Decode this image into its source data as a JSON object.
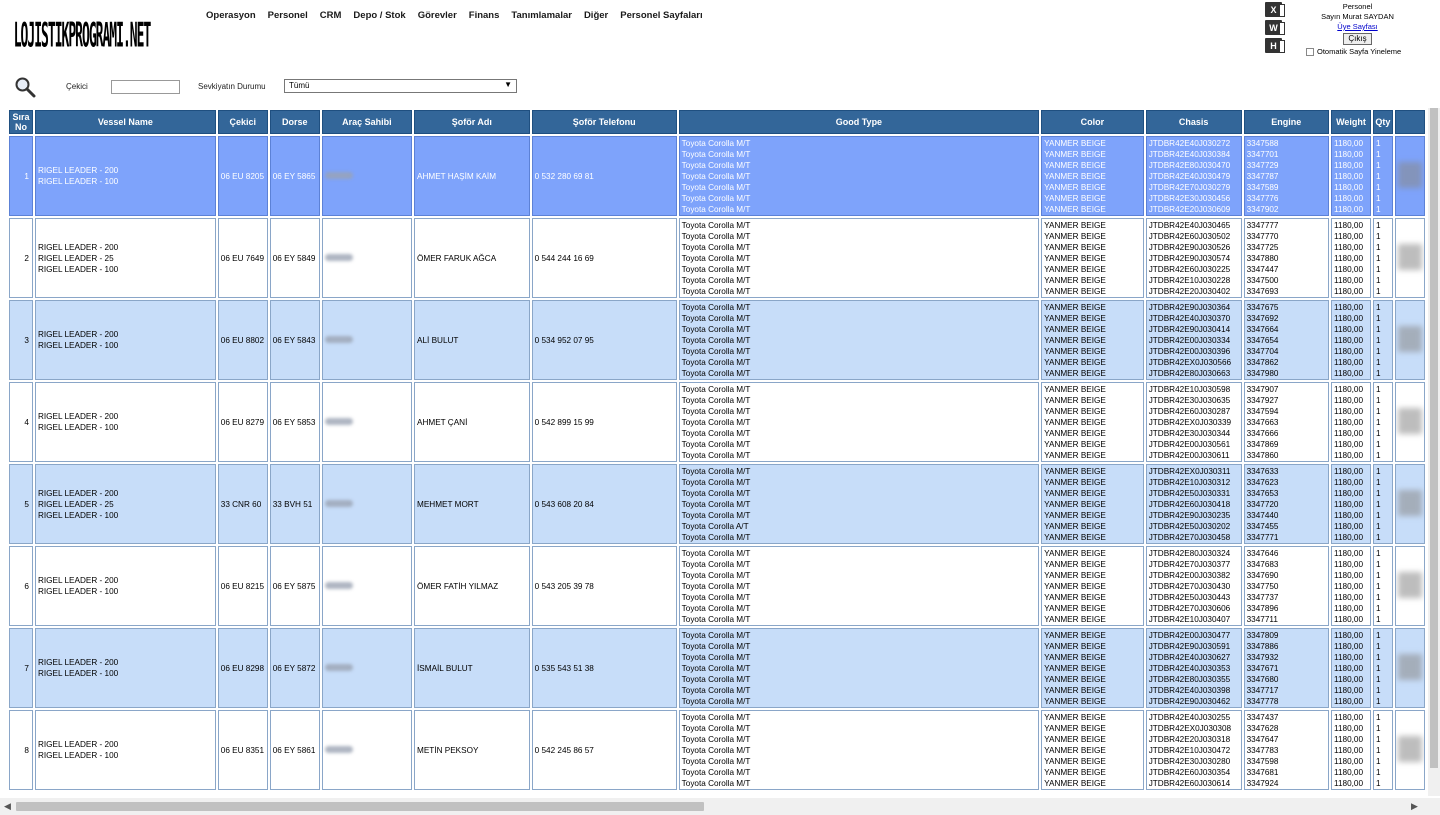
{
  "brand": {
    "logo_text": "LOJISTIKPROGRAMI.NET"
  },
  "menu": [
    "Operasyon",
    "Personel",
    "CRM",
    "Depo / Stok",
    "Görevler",
    "Finans",
    "Tanımlamalar",
    "Diğer",
    "Personel Sayfaları"
  ],
  "export": {
    "icons": [
      "excel-icon",
      "word-icon",
      "html-icon"
    ],
    "letters": [
      "X",
      "W",
      "H"
    ]
  },
  "user": {
    "role": "Personel",
    "greeting": "Sayın Murat SAYDAN",
    "profile_link": "Üye Sayfası",
    "logout": "Çıkış",
    "auto_refresh": "Otomatik Sayfa Yineleme"
  },
  "filters": {
    "cekici_label": "Çekici",
    "cekici_value": "",
    "status_label": "Sevkiyatın Durumu",
    "status_value": "Tümü"
  },
  "table": {
    "columns": [
      "Sıra No",
      "Vessel Name",
      "Çekici",
      "Dorse",
      "Araç Sahibi",
      "Şoför Adı",
      "Şoför Telefonu",
      "Good Type",
      "Color",
      "Chasis",
      "Engine",
      "Weight",
      "Qty"
    ],
    "rows": [
      {
        "no": "1",
        "vessels": [
          "RIGEL LEADER - 200",
          "RIGEL LEADER - 100"
        ],
        "cekici": "06 EU 8205",
        "dorse": "06 EY 5865",
        "driver": "AHMET HAŞİM KAİM",
        "phone": "0 532 280 69 81",
        "goods": [
          "Toyota Corolla M/T",
          "Toyota Corolla M/T",
          "Toyota Corolla M/T",
          "Toyota Corolla M/T",
          "Toyota Corolla M/T",
          "Toyota Corolla M/T",
          "Toyota Corolla M/T"
        ],
        "colors": [
          "YANMER BEIGE",
          "YANMER BEIGE",
          "YANMER BEIGE",
          "YANMER BEIGE",
          "YANMER BEIGE",
          "YANMER BEIGE",
          "YANMER BEIGE"
        ],
        "chasis": [
          "JTDBR42E40J030272",
          "JTDBR42E40J030384",
          "JTDBR42E80J030470",
          "JTDBR42E40J030479",
          "JTDBR42E70J030279",
          "JTDBR42E30J030456",
          "JTDBR42E20J030609"
        ],
        "engine": [
          "3347588",
          "3347701",
          "3347729",
          "3347787",
          "3347589",
          "3347776",
          "3347902"
        ],
        "weight": [
          "1180,00",
          "1180,00",
          "1180,00",
          "1180,00",
          "1180,00",
          "1180,00",
          "1180,00"
        ],
        "qty": [
          "1",
          "1",
          "1",
          "1",
          "1",
          "1",
          "1"
        ]
      },
      {
        "no": "2",
        "vessels": [
          "RIGEL LEADER - 200",
          "RIGEL LEADER - 25",
          "RIGEL LEADER - 100"
        ],
        "cekici": "06 EU 7649",
        "dorse": "06 EY 5849",
        "driver": "ÖMER FARUK AĞCA",
        "phone": "0 544 244 16 69",
        "goods": [
          "Toyota Corolla M/T",
          "Toyota Corolla M/T",
          "Toyota Corolla M/T",
          "Toyota Corolla M/T",
          "Toyota Corolla M/T",
          "Toyota Corolla M/T",
          "Toyota Corolla M/T"
        ],
        "colors": [
          "YANMER BEIGE",
          "YANMER BEIGE",
          "YANMER BEIGE",
          "YANMER BEIGE",
          "YANMER BEIGE",
          "YANMER BEIGE",
          "YANMER BEIGE"
        ],
        "chasis": [
          "JTDBR42E40J030465",
          "JTDBR42E60J030502",
          "JTDBR42E90J030526",
          "JTDBR42E90J030574",
          "JTDBR42E60J030225",
          "JTDBR42E10J030228",
          "JTDBR42E20J030402"
        ],
        "engine": [
          "3347777",
          "3347770",
          "3347725",
          "3347880",
          "3347447",
          "3347500",
          "3347693"
        ],
        "weight": [
          "1180,00",
          "1180,00",
          "1180,00",
          "1180,00",
          "1180,00",
          "1180,00",
          "1180,00"
        ],
        "qty": [
          "1",
          "1",
          "1",
          "1",
          "1",
          "1",
          "1"
        ]
      },
      {
        "no": "3",
        "vessels": [
          "RIGEL LEADER - 200",
          "RIGEL LEADER - 100"
        ],
        "cekici": "06 EU 8802",
        "dorse": "06 EY 5843",
        "driver": "ALİ BULUT",
        "phone": "0 534 952 07 95",
        "goods": [
          "Toyota Corolla M/T",
          "Toyota Corolla M/T",
          "Toyota Corolla M/T",
          "Toyota Corolla M/T",
          "Toyota Corolla M/T",
          "Toyota Corolla M/T",
          "Toyota Corolla M/T"
        ],
        "colors": [
          "YANMER BEIGE",
          "YANMER BEIGE",
          "YANMER BEIGE",
          "YANMER BEIGE",
          "YANMER BEIGE",
          "YANMER BEIGE",
          "YANMER BEIGE"
        ],
        "chasis": [
          "JTDBR42E90J030364",
          "JTDBR42E40J030370",
          "JTDBR42E90J030414",
          "JTDBR42E00J030334",
          "JTDBR42E00J030396",
          "JTDBR42EX0J030566",
          "JTDBR42E80J030663"
        ],
        "engine": [
          "3347675",
          "3347692",
          "3347664",
          "3347654",
          "3347704",
          "3347862",
          "3347980"
        ],
        "weight": [
          "1180,00",
          "1180,00",
          "1180,00",
          "1180,00",
          "1180,00",
          "1180,00",
          "1180,00"
        ],
        "qty": [
          "1",
          "1",
          "1",
          "1",
          "1",
          "1",
          "1"
        ]
      },
      {
        "no": "4",
        "vessels": [
          "RIGEL LEADER - 200",
          "RIGEL LEADER - 100"
        ],
        "cekici": "06 EU 8279",
        "dorse": "06 EY 5853",
        "driver": "AHMET ÇANİ",
        "phone": "0 542 899 15 99",
        "goods": [
          "Toyota Corolla M/T",
          "Toyota Corolla M/T",
          "Toyota Corolla M/T",
          "Toyota Corolla M/T",
          "Toyota Corolla M/T",
          "Toyota Corolla M/T",
          "Toyota Corolla M/T"
        ],
        "colors": [
          "YANMER BEIGE",
          "YANMER BEIGE",
          "YANMER BEIGE",
          "YANMER BEIGE",
          "YANMER BEIGE",
          "YANMER BEIGE",
          "YANMER BEIGE"
        ],
        "chasis": [
          "JTDBR42E10J030598",
          "JTDBR42E30J030635",
          "JTDBR42E60J030287",
          "JTDBR42EX0J030339",
          "JTDBR42E30J030344",
          "JTDBR42E00J030561",
          "JTDBR42E00J030611"
        ],
        "engine": [
          "3347907",
          "3347927",
          "3347594",
          "3347663",
          "3347666",
          "3347869",
          "3347860"
        ],
        "weight": [
          "1180,00",
          "1180,00",
          "1180,00",
          "1180,00",
          "1180,00",
          "1180,00",
          "1180,00"
        ],
        "qty": [
          "1",
          "1",
          "1",
          "1",
          "1",
          "1",
          "1"
        ]
      },
      {
        "no": "5",
        "vessels": [
          "RIGEL LEADER - 200",
          "RIGEL LEADER - 25",
          "RIGEL LEADER - 100"
        ],
        "cekici": "33 CNR 60",
        "dorse": "33 BVH 51",
        "driver": "MEHMET MORT",
        "phone": "0 543 608 20 84",
        "goods": [
          "Toyota Corolla M/T",
          "Toyota Corolla M/T",
          "Toyota Corolla M/T",
          "Toyota Corolla M/T",
          "Toyota Corolla M/T",
          "Toyota Corolla A/T",
          "Toyota Corolla M/T"
        ],
        "colors": [
          "YANMER BEIGE",
          "YANMER BEIGE",
          "YANMER BEIGE",
          "YANMER BEIGE",
          "YANMER BEIGE",
          "YANMER BEIGE",
          "YANMER BEIGE"
        ],
        "chasis": [
          "JTDBR42EX0J030311",
          "JTDBR42E10J030312",
          "JTDBR42E50J030331",
          "JTDBR42E60J030418",
          "JTDBR42E90J030235",
          "JTDBR42E50J030202",
          "JTDBR42E70J030458"
        ],
        "engine": [
          "3347633",
          "3347623",
          "3347653",
          "3347720",
          "3347440",
          "3347455",
          "3347771"
        ],
        "weight": [
          "1180,00",
          "1180,00",
          "1180,00",
          "1180,00",
          "1180,00",
          "1180,00",
          "1180,00"
        ],
        "qty": [
          "1",
          "1",
          "1",
          "1",
          "1",
          "1",
          "1"
        ]
      },
      {
        "no": "6",
        "vessels": [
          "RIGEL LEADER - 200",
          "RIGEL LEADER - 100"
        ],
        "cekici": "06 EU 8215",
        "dorse": "06 EY 5875",
        "driver": "ÖMER FATİH YILMAZ",
        "phone": "0 543 205 39 78",
        "goods": [
          "Toyota Corolla M/T",
          "Toyota Corolla M/T",
          "Toyota Corolla M/T",
          "Toyota Corolla M/T",
          "Toyota Corolla M/T",
          "Toyota Corolla M/T",
          "Toyota Corolla M/T"
        ],
        "colors": [
          "YANMER BEIGE",
          "YANMER BEIGE",
          "YANMER BEIGE",
          "YANMER BEIGE",
          "YANMER BEIGE",
          "YANMER BEIGE",
          "YANMER BEIGE"
        ],
        "chasis": [
          "JTDBR42E80J030324",
          "JTDBR42E70J030377",
          "JTDBR42E00J030382",
          "JTDBR42E70J030430",
          "JTDBR42E50J030443",
          "JTDBR42E70J030606",
          "JTDBR42E10J030407"
        ],
        "engine": [
          "3347646",
          "3347683",
          "3347690",
          "3347750",
          "3347737",
          "3347896",
          "3347711"
        ],
        "weight": [
          "1180,00",
          "1180,00",
          "1180,00",
          "1180,00",
          "1180,00",
          "1180,00",
          "1180,00"
        ],
        "qty": [
          "1",
          "1",
          "1",
          "1",
          "1",
          "1",
          "1"
        ]
      },
      {
        "no": "7",
        "vessels": [
          "RIGEL LEADER - 200",
          "RIGEL LEADER - 100"
        ],
        "cekici": "06 EU 8298",
        "dorse": "06 EY 5872",
        "driver": "İSMAİL BULUT",
        "phone": "0 535 543 51 38",
        "goods": [
          "Toyota Corolla M/T",
          "Toyota Corolla M/T",
          "Toyota Corolla M/T",
          "Toyota Corolla M/T",
          "Toyota Corolla M/T",
          "Toyota Corolla M/T",
          "Toyota Corolla M/T"
        ],
        "colors": [
          "YANMER BEIGE",
          "YANMER BEIGE",
          "YANMER BEIGE",
          "YANMER BEIGE",
          "YANMER BEIGE",
          "YANMER BEIGE",
          "YANMER BEIGE"
        ],
        "chasis": [
          "JTDBR42E00J030477",
          "JTDBR42E90J030591",
          "JTDBR42E40J030627",
          "JTDBR42E40J030353",
          "JTDBR42E80J030355",
          "JTDBR42E40J030398",
          "JTDBR42E90J030462"
        ],
        "engine": [
          "3347809",
          "3347886",
          "3347932",
          "3347671",
          "3347680",
          "3347717",
          "3347778"
        ],
        "weight": [
          "1180,00",
          "1180,00",
          "1180,00",
          "1180,00",
          "1180,00",
          "1180,00",
          "1180,00"
        ],
        "qty": [
          "1",
          "1",
          "1",
          "1",
          "1",
          "1",
          "1"
        ]
      },
      {
        "no": "8",
        "vessels": [
          "RIGEL LEADER - 200",
          "RIGEL LEADER - 100"
        ],
        "cekici": "06 EU 8351",
        "dorse": "06 EY 5861",
        "driver": "METİN PEKSOY",
        "phone": "0 542 245 86 57",
        "goods": [
          "Toyota Corolla M/T",
          "Toyota Corolla M/T",
          "Toyota Corolla M/T",
          "Toyota Corolla M/T",
          "Toyota Corolla M/T",
          "Toyota Corolla M/T",
          "Toyota Corolla M/T"
        ],
        "colors": [
          "YANMER BEIGE",
          "YANMER BEIGE",
          "YANMER BEIGE",
          "YANMER BEIGE",
          "YANMER BEIGE",
          "YANMER BEIGE",
          "YANMER BEIGE"
        ],
        "chasis": [
          "JTDBR42E40J030255",
          "JTDBR42EX0J030308",
          "JTDBR42E20J030318",
          "JTDBR42E10J030472",
          "JTDBR42E30J030280",
          "JTDBR42E60J030354",
          "JTDBR42E60J030614"
        ],
        "engine": [
          "3347437",
          "3347628",
          "3347647",
          "3347783",
          "3347598",
          "3347681",
          "3347924"
        ],
        "weight": [
          "1180,00",
          "1180,00",
          "1180,00",
          "1180,00",
          "1180,00",
          "1180,00",
          "1180,00"
        ],
        "qty": [
          "1",
          "1",
          "1",
          "1",
          "1",
          "1",
          "1"
        ]
      }
    ]
  },
  "colors": {
    "header_bg": "#336699",
    "selected_row": "#7ea3fb",
    "alt_row": "#c7ddf9"
  }
}
